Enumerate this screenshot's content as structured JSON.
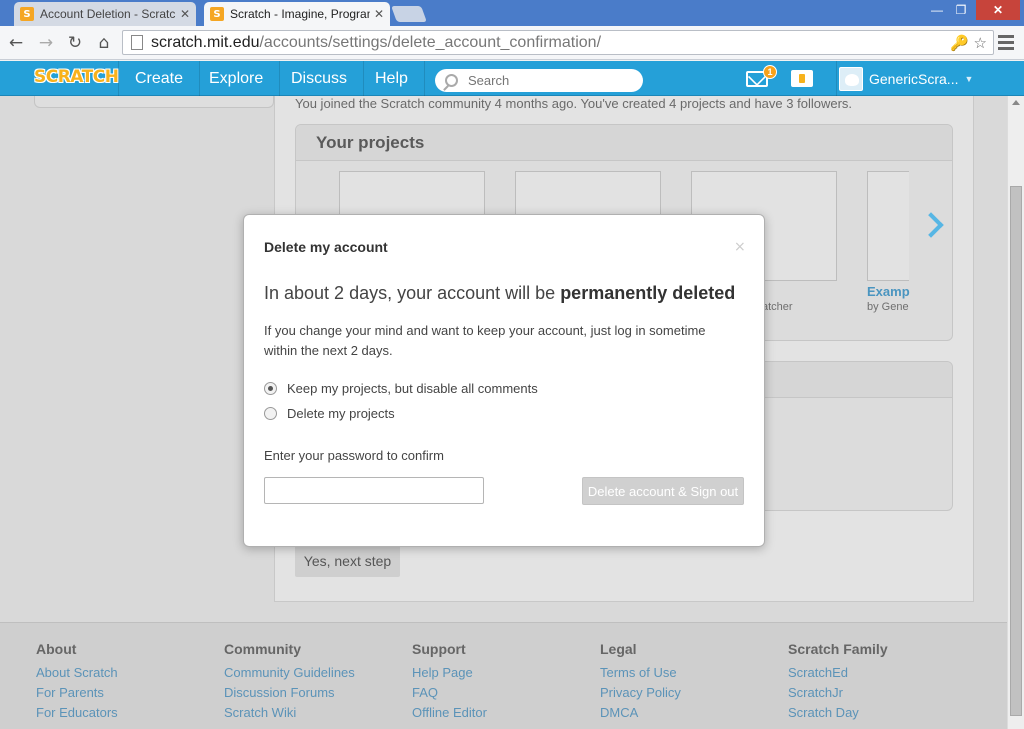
{
  "browser": {
    "tabs": [
      {
        "title": "Account Deletion - Scratch",
        "active": false
      },
      {
        "title": "Scratch - Imagine, Program",
        "active": true
      }
    ],
    "favicon_glyph": "S",
    "close_glyph": "✕",
    "window": {
      "minimize": "—",
      "maximize": "❐",
      "close": "✕"
    },
    "url": {
      "host": "scratch.mit.edu",
      "path": "/accounts/settings/delete_account_confirmation/"
    },
    "nav_icons": {
      "back": "←",
      "forward": "→",
      "reload": "↻",
      "home": "⌂"
    },
    "omni_icons": "🔑 ☆"
  },
  "header": {
    "logo": "SCRATCH",
    "nav": [
      "Create",
      "Explore",
      "Discuss",
      "Help"
    ],
    "search_placeholder": "Search",
    "notification_count": "1",
    "username": "GenericScra...",
    "caret": "▼",
    "brand_color": "#25a0d8"
  },
  "page": {
    "joined_text": "You joined the Scratch community 4 months ago. You've created 4 projects and have 3 followers.",
    "projects_title": "Your projects",
    "project_caption_partial": "atcher",
    "project_link_partial": "Examp",
    "project_by_partial": "by Gene",
    "next_step_label": "Yes, next step"
  },
  "modal": {
    "title": "Delete my account",
    "close": "×",
    "headline_prefix": "In about 2 days, your account will be ",
    "headline_bold": "permanently deleted",
    "body": "If you change your mind and want to keep your account, just log in sometime within the next 2 days.",
    "options": [
      {
        "label": "Keep my projects, but disable all comments",
        "checked": true
      },
      {
        "label": "Delete my projects",
        "checked": false
      }
    ],
    "password_label": "Enter your password to confirm",
    "password_value": "",
    "submit_label": "Delete account & Sign out"
  },
  "footer": {
    "columns": [
      {
        "title": "About",
        "links": [
          "About Scratch",
          "For Parents",
          "For Educators"
        ]
      },
      {
        "title": "Community",
        "links": [
          "Community Guidelines",
          "Discussion Forums",
          "Scratch Wiki"
        ]
      },
      {
        "title": "Support",
        "links": [
          "Help Page",
          "FAQ",
          "Offline Editor"
        ]
      },
      {
        "title": "Legal",
        "links": [
          "Terms of Use",
          "Privacy Policy",
          "DMCA"
        ]
      },
      {
        "title": "Scratch Family",
        "links": [
          "ScratchEd",
          "ScratchJr",
          "Scratch Day"
        ]
      }
    ]
  }
}
